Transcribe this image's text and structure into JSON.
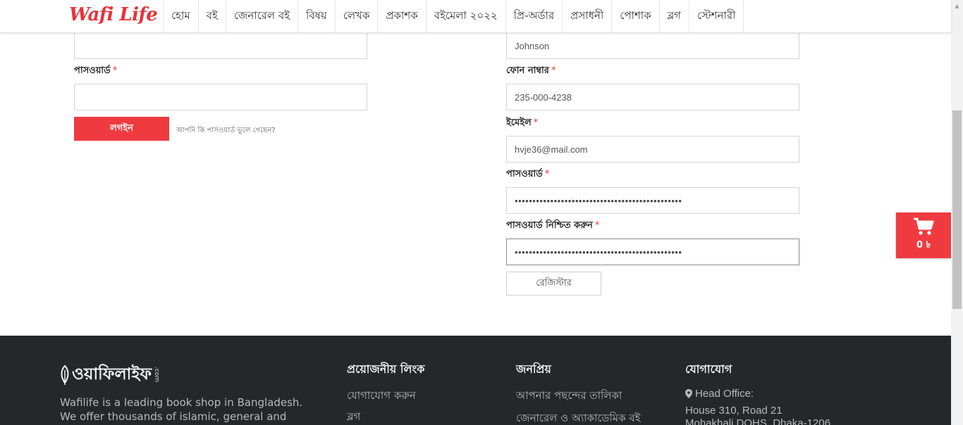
{
  "header": {
    "logo": "Wafi Life",
    "nav": [
      "হোম",
      "বই",
      "জেনারেল বই",
      "বিষয়",
      "লেখক",
      "প্রকাশক",
      "বইমেলা ২০২২",
      "প্রি-অর্ডার",
      "প্রসাধনী",
      "পোশাক",
      "ব্লগ",
      "স্টেশনারী"
    ]
  },
  "login": {
    "password_label": "পাসওয়ার্ড",
    "required_mark": "*",
    "username_value": "",
    "password_value": "",
    "login_button": "লগইন",
    "forgot_link": "আপনি কি পাসওয়ার্ড ভুলে গেছেন?"
  },
  "register": {
    "last_name_value": "Johnson",
    "phone_label": "ফোন নাম্বার",
    "phone_value": "235-000-4238",
    "email_label": "ইমেইল",
    "email_value": "hvje36@mail.com",
    "password_label": "পাসওয়ার্ড",
    "password_value": "•••••••••••••••••••••••••••••••••••••••••••••••",
    "confirm_label": "পাসওয়ার্ড নিশ্চিত করুন",
    "confirm_value": "•••••••••••••••••••••••••••••••••••••••••••••••",
    "register_button": "রেজিস্টার"
  },
  "cart": {
    "icon": "shopping-cart-icon",
    "amount": "0 ৳"
  },
  "footer": {
    "logo_text": "ওয়াফিলাইফ",
    "logo_suffix": ".com",
    "description": "Wafilife is a leading book shop in Bangladesh. We offer thousands of islamic, general and academic",
    "links_heading": "প্রয়োজনীয় লিংক",
    "links": [
      "যোগাযোগ করুন",
      "ব্লগ"
    ],
    "popular_heading": "জনপ্রিয়",
    "popular": [
      "আপনার পছন্দের তালিকা",
      "জেনারেল ও অ্যাকাডেমিক বই"
    ],
    "contact_heading": "যোগাযোগ",
    "office_label": "Head Office:",
    "address_line1": "House 310, Road 21",
    "address_line2": "Mohakhali DOHS, Dhaka-1206"
  },
  "colors": {
    "accent": "#ef3b3f",
    "footer_bg": "#26272b"
  }
}
